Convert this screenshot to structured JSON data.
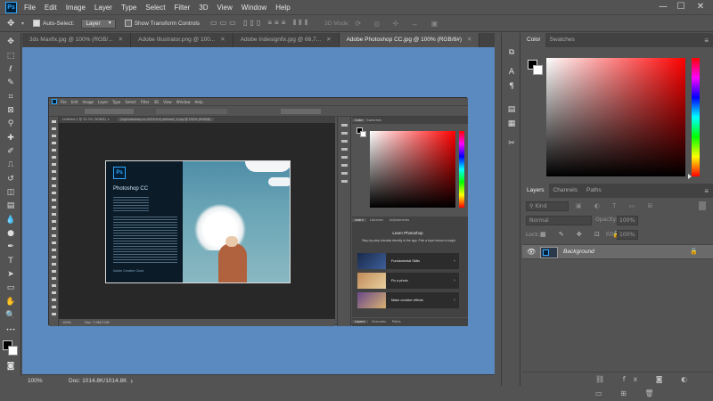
{
  "app": {
    "logo": "Ps"
  },
  "menubar": {
    "items": [
      "File",
      "Edit",
      "Image",
      "Layer",
      "Type",
      "Select",
      "Filter",
      "3D",
      "View",
      "Window",
      "Help"
    ],
    "controls": {
      "minimize": "—",
      "maximize": "☐",
      "close": "✕"
    }
  },
  "options": {
    "auto_select_label": "Auto-Select:",
    "auto_select_value": "Layer",
    "transform_label": "Show Transform Controls",
    "mode_label": "3D Mode:"
  },
  "tabs": [
    {
      "label": "3ds Maxfix.jpg @ 100% (RGB/..."
    },
    {
      "label": "Adobe Illustrator.png @ 100..."
    },
    {
      "label": "Adobe Indesignfix.jpg @ 66,7..."
    },
    {
      "label": "Adobe Photoshop CC.jpg @ 100% (RGB/8#)",
      "active": true
    }
  ],
  "status": {
    "zoom": "100%",
    "doc": "Doc: 1014.8K/1014.8K"
  },
  "panel": {
    "color_tabs": [
      "Color",
      "Swatches"
    ],
    "layers_tabs": [
      "Layers",
      "Channels",
      "Paths"
    ],
    "kind_label": "Kind",
    "blend_mode": "Normal",
    "opacity_label": "Opacity:",
    "opacity_value": "100%",
    "lock_label": "Lock:",
    "fill_label": "Fill:",
    "fill_value": "100%",
    "layer_name": "Background"
  },
  "embedded": {
    "menus": [
      "File",
      "Edit",
      "Image",
      "Layer",
      "Type",
      "Select",
      "Filter",
      "3D",
      "View",
      "Window",
      "Help"
    ],
    "tab_label": "Untitled-1 @ 33.3% (RGB/8) ×",
    "tab2_label": "(b)photoshop-cc-2019-full_without_1.jpg @ 100% (RGB/8)",
    "splash_logo": "Ps",
    "splash_title": "Photoshop CC",
    "splash_footer": "Adobe Creative Cloud",
    "learn_tabs": [
      "Learn",
      "Libraries",
      "Adjustments"
    ],
    "learn_title": "Learn Photoshop",
    "learn_desc": "Step-by-step tutorials directly in the app. Pick a topic below to begin.",
    "learn_items": [
      "Fundamental Skills",
      "Fix a photo",
      "Make creative effects"
    ],
    "bottom_tabs": [
      "Layers",
      "Channels",
      "Paths"
    ],
    "zoom": "100%",
    "doc": "Doc: 7.0M/7.0M"
  },
  "colors": {
    "canvas_bg": "#5b8ac0",
    "chrome_bg": "#535353",
    "dark_bg": "#424242",
    "ps_blue": "#31a8ff",
    "ps_navy": "#001e36"
  }
}
